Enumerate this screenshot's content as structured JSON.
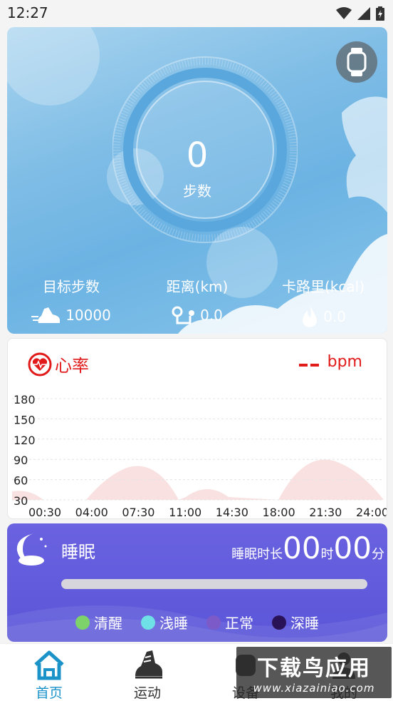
{
  "status": {
    "time": "12:27"
  },
  "steps": {
    "count": "0",
    "label": "步数",
    "goal_label": "目标步数",
    "goal_value": "10000",
    "distance_label": "距离(km)",
    "distance_value": "0.0",
    "calories_label": "卡路里(kcal)",
    "calories_value": "0.0"
  },
  "heart_rate": {
    "title": "心率",
    "unit": "bpm",
    "y_ticks": [
      "180",
      "150",
      "120",
      "90",
      "60",
      "30"
    ],
    "x_ticks": [
      "00:30",
      "04:00",
      "07:30",
      "11:00",
      "14:30",
      "18:00",
      "21:30",
      "24:00"
    ]
  },
  "sleep": {
    "title": "睡眠",
    "duration_label": "睡眠时长",
    "hours": "00",
    "hours_unit": "时",
    "minutes": "00",
    "minutes_unit": "分",
    "legend": [
      {
        "label": "清醒",
        "color": "#7dd36a"
      },
      {
        "label": "浅睡",
        "color": "#6fe0e6"
      },
      {
        "label": "正常",
        "color": "#7c5bc8"
      },
      {
        "label": "深睡",
        "color": "#2a1257"
      }
    ]
  },
  "nav": {
    "home": "首页",
    "sport": "运动",
    "device": "设备",
    "mine": "我的"
  },
  "watermark": {
    "line1": "下载鸟应用",
    "line2": "www.xiazainiao.com"
  },
  "colors": {
    "accent": "#1b93c9",
    "heart": "#e11a1a",
    "sleep_bg": "#5b56d8"
  }
}
